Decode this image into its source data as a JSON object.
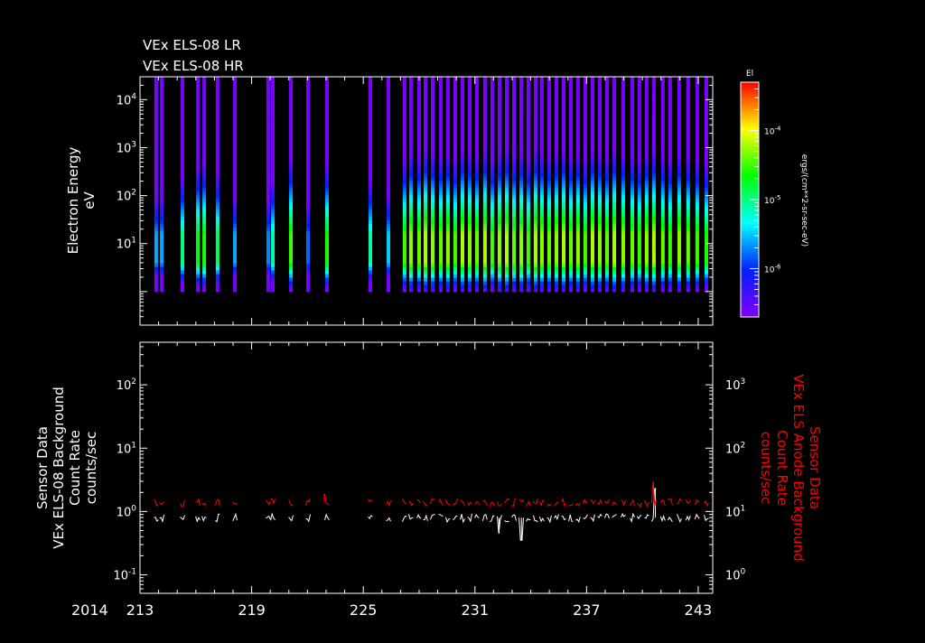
{
  "chart_data": [
    {
      "type": "heatmap",
      "titles": [
        "VEx ELS-08 LR",
        "VEx ELS-08 HR"
      ],
      "ylabel": [
        "Electron Energy",
        "eV"
      ],
      "yscale": "log",
      "ylim": [
        0.2,
        30000
      ],
      "yticks": [
        {
          "value": 10,
          "base": "10",
          "exp": "1"
        },
        {
          "value": 100,
          "base": "10",
          "exp": "2"
        },
        {
          "value": 1000,
          "base": "10",
          "exp": "3"
        },
        {
          "value": 10000,
          "base": "10",
          "exp": "4"
        }
      ],
      "xlim": [
        213,
        243.78
      ],
      "energy_range": [
        1,
        30000
      ],
      "stripe_days": [
        213.87,
        214.17,
        215.28,
        216.11,
        216.45,
        217.17,
        218.1,
        219.89,
        220.14,
        221.11,
        222.03,
        223.05,
        225.38,
        226.35,
        227.22,
        227.56,
        228.0,
        228.34,
        228.73,
        229.17,
        229.55,
        229.94,
        230.33,
        230.72,
        231.11,
        231.54,
        231.93,
        232.32,
        232.71,
        233.1,
        233.49,
        233.87,
        234.26,
        234.6,
        234.99,
        235.38,
        235.77,
        236.16,
        236.54,
        236.93,
        237.32,
        237.71,
        238.1,
        238.49,
        238.97,
        239.46,
        239.84,
        240.23,
        240.62,
        241.1,
        241.49,
        241.98,
        242.46,
        242.95,
        243.44
      ],
      "stripe_peak_log_flux": [
        -5.6,
        -5.6,
        -5.0,
        -4.7,
        -4.6,
        -4.9,
        -5.6,
        -5.7,
        -5.1,
        -4.5,
        -5.8,
        -4.6,
        -5.1,
        -5.5,
        -4.5,
        -4.3,
        -4.4,
        -4.2,
        -4.3,
        -4.4,
        -4.3,
        -4.5,
        -4.2,
        -4.3,
        -4.4,
        -4.2,
        -4.5,
        -4.3,
        -4.2,
        -4.4,
        -4.3,
        -4.5,
        -4.2,
        -4.3,
        -4.4,
        -4.3,
        -4.2,
        -4.4,
        -4.3,
        -4.5,
        -4.2,
        -4.3,
        -4.4,
        -4.2,
        -4.3,
        -4.4,
        -4.5,
        -4.3,
        -4.2,
        -4.4,
        -4.5,
        -4.3,
        -4.4,
        -4.5,
        -4.6
      ],
      "colorbar": {
        "label": "El",
        "units": "ergs/(cm**2-sr-sec-eV)",
        "log_range": [
          -6.7,
          -3.3
        ],
        "ticks": [
          {
            "value": -4,
            "base": "10",
            "exp": "-4"
          },
          {
            "value": -5,
            "base": "10",
            "exp": "-5"
          },
          {
            "value": -6,
            "base": "10",
            "exp": "-6"
          }
        ]
      }
    },
    {
      "type": "line",
      "ylabel_left": [
        "Sensor Data",
        "VEx ELS-08 Background",
        "Count Rate",
        "counts/sec"
      ],
      "ylabel_right": [
        "Sensor Data",
        "VEx ELS Anode Background",
        "Count Rate",
        "counts/sec"
      ],
      "yscale": "log",
      "ylim_left": [
        0.051,
        470
      ],
      "ylim_right": [
        0.51,
        4700
      ],
      "yticks_left": [
        {
          "value": 0.1,
          "base": "10",
          "exp": "-1"
        },
        {
          "value": 1,
          "base": "10",
          "exp": "0"
        },
        {
          "value": 10,
          "base": "10",
          "exp": "1"
        },
        {
          "value": 100,
          "base": "10",
          "exp": "2"
        }
      ],
      "yticks_right": [
        {
          "value": 1,
          "base": "10",
          "exp": "0"
        },
        {
          "value": 10,
          "base": "10",
          "exp": "1"
        },
        {
          "value": 100,
          "base": "10",
          "exp": "2"
        },
        {
          "value": 1000,
          "base": "10",
          "exp": "3"
        }
      ],
      "xlim": [
        213,
        243.78
      ],
      "xticks": [
        "213",
        "219",
        "225",
        "231",
        "237",
        "243"
      ],
      "xtick_values": [
        213,
        219,
        225,
        231,
        237,
        243
      ],
      "year_label": "2014",
      "series": [
        {
          "name": "VEx ELS-08 Background Count Rate",
          "axis": "left",
          "color": "#ffffff",
          "typical": 0.8,
          "spikes": [
            {
              "day": 233.5,
              "value": 0.35
            },
            {
              "day": 232.3,
              "value": 0.45
            },
            {
              "day": 240.7,
              "value": 2.3
            }
          ]
        },
        {
          "name": "VEx ELS Anode Background Count Rate",
          "axis": "right",
          "color": "#ff0000",
          "typical": 14,
          "spikes": [
            {
              "day": 240.6,
              "value": 30
            },
            {
              "day": 222.9,
              "value": 19
            }
          ]
        }
      ]
    }
  ]
}
